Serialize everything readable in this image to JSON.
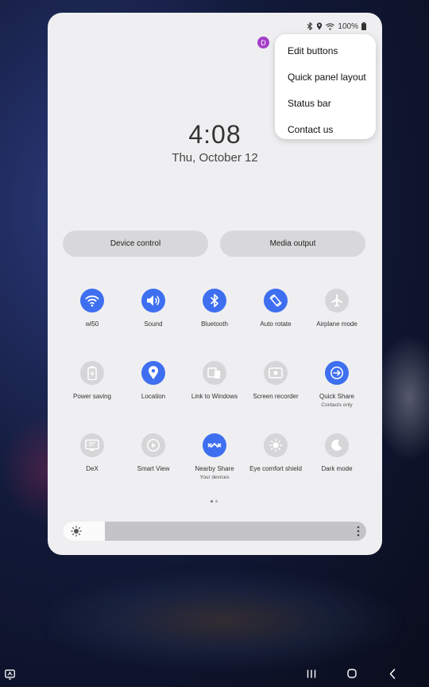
{
  "status_bar": {
    "battery": "100%"
  },
  "avatar_initial": "D",
  "clock": {
    "time": "4:08",
    "date": "Thu, October 12"
  },
  "pills": {
    "device_control": "Device control",
    "media_output": "Media output"
  },
  "tiles": [
    {
      "label": "wl50",
      "sub": "",
      "active": true,
      "icon": "wifi-icon"
    },
    {
      "label": "Sound",
      "sub": "",
      "active": true,
      "icon": "sound-icon"
    },
    {
      "label": "Bluetooth",
      "sub": "",
      "active": true,
      "icon": "bluetooth-icon"
    },
    {
      "label": "Auto rotate",
      "sub": "",
      "active": true,
      "icon": "rotate-icon"
    },
    {
      "label": "Airplane mode",
      "sub": "",
      "active": false,
      "icon": "airplane-icon"
    },
    {
      "label": "Power saving",
      "sub": "",
      "active": false,
      "icon": "battery-icon"
    },
    {
      "label": "Location",
      "sub": "",
      "active": true,
      "icon": "location-icon"
    },
    {
      "label": "Link to Windows",
      "sub": "",
      "active": false,
      "icon": "windows-link-icon"
    },
    {
      "label": "Screen recorder",
      "sub": "",
      "active": false,
      "icon": "screen-recorder-icon"
    },
    {
      "label": "Quick Share",
      "sub": "Contacts only",
      "active": true,
      "icon": "quick-share-icon"
    },
    {
      "label": "DeX",
      "sub": "",
      "active": false,
      "icon": "dex-icon"
    },
    {
      "label": "Smart View",
      "sub": "",
      "active": false,
      "icon": "smart-view-icon"
    },
    {
      "label": "Nearby Share",
      "sub": "Your devices",
      "active": true,
      "icon": "nearby-share-icon"
    },
    {
      "label": "Eye comfort shield",
      "sub": "",
      "active": false,
      "icon": "eye-comfort-icon"
    },
    {
      "label": "Dark mode",
      "sub": "",
      "active": false,
      "icon": "moon-icon"
    }
  ],
  "brightness": {
    "level": 0.14
  },
  "menu": {
    "items": [
      "Edit buttons",
      "Quick panel layout",
      "Status bar",
      "Contact us"
    ]
  },
  "colors": {
    "accent": "#3e6ff0",
    "inactive": "#d6d6d8",
    "panel": "#efeff1"
  }
}
